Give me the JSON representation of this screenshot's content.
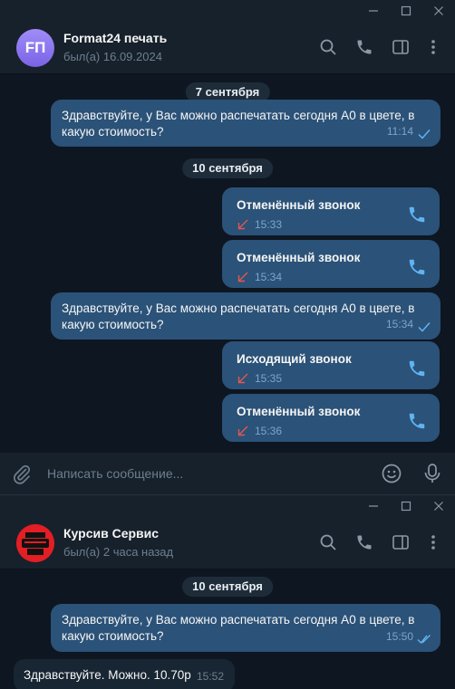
{
  "window1": {
    "header": {
      "avatar_initials": "FП",
      "avatar_color": "#8a74f0",
      "title": "Format24 печать",
      "status": "был(а) 16.09.2024"
    },
    "chat": {
      "date1": "7 сентября",
      "msg1": {
        "text": "Здравствуйте, у Вас можно распечатать сегодня А0 в цвете, в какую стоимость?",
        "time": "11:14"
      },
      "date2": "10 сентября",
      "call1": {
        "title": "Отменённый звонок",
        "time": "15:33"
      },
      "call2": {
        "title": "Отменённый звонок",
        "time": "15:34"
      },
      "msg2": {
        "text": "Здравствуйте, у Вас можно распечатать сегодня А0 в цвете, в какую стоимость?",
        "time": "15:34"
      },
      "call3": {
        "title": "Исходящий звонок",
        "time": "15:35"
      },
      "call4": {
        "title": "Отменённый звонок",
        "time": "15:36"
      }
    },
    "composer": {
      "placeholder": "Написать сообщение..."
    }
  },
  "window2": {
    "header": {
      "title": "Курсив Сервис",
      "status": "был(а) 2 часа назад",
      "avatar_color": "#e31e24"
    },
    "chat": {
      "date1": "10 сентября",
      "msg1": {
        "text": "Здравствуйте, у Вас можно распечатать сегодня А0 в цвете, в какую стоимость?",
        "time": "15:50"
      },
      "msg2": {
        "text": "Здравствуйте. Можно. 10.70р",
        "time": "15:52"
      }
    }
  },
  "colors": {
    "bg": "#0e1621",
    "panel": "#17212b",
    "outgoing_bubble": "#2b5278",
    "incoming_bubble": "#182533",
    "accent": "#5fb3f2",
    "missed_call": "#e0584f"
  }
}
